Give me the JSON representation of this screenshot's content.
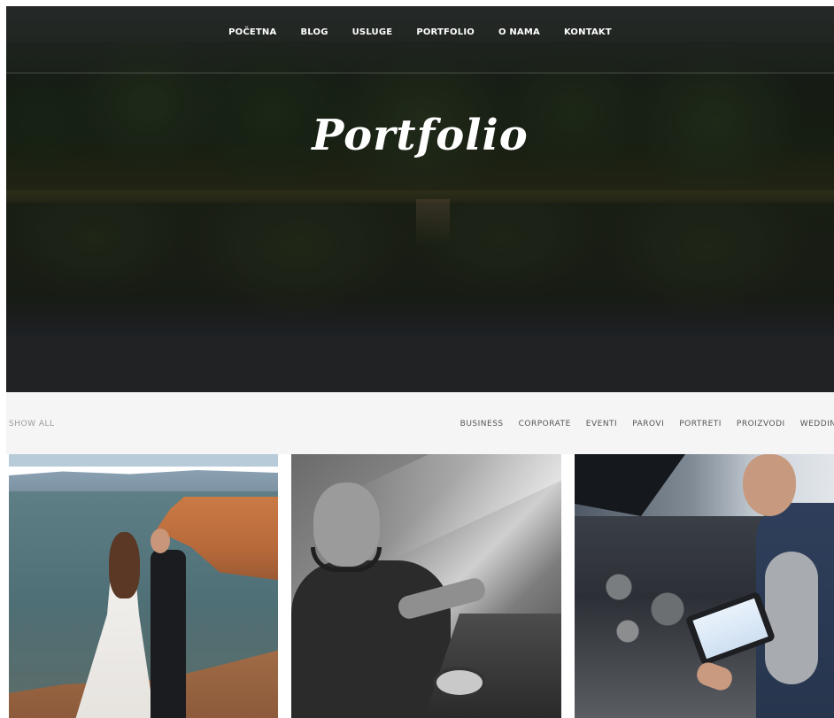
{
  "nav": {
    "items": [
      "POČETNA",
      "BLOG",
      "USLUGE",
      "PORTFOLIO",
      "O NAMA",
      "KONTAKT"
    ]
  },
  "hero": {
    "title": "Portfolio"
  },
  "filters": {
    "show_all": "SHOW ALL",
    "categories": [
      "BUSINESS",
      "CORPORATE",
      "EVENTI",
      "PAROVI",
      "PORTRETI",
      "PROIZVODI",
      "WEDDING"
    ]
  },
  "gallery": {
    "tiles": [
      {
        "subject": "couple-on-cliff-photo"
      },
      {
        "subject": "dj-at-deck-photo"
      },
      {
        "subject": "mechanic-with-tablet-photo"
      }
    ]
  },
  "colors": {
    "filter_bar_bg": "#f5f5f5",
    "nav_text": "#ffffff",
    "filter_text": "#555555",
    "filter_muted": "#9a9a9a"
  }
}
